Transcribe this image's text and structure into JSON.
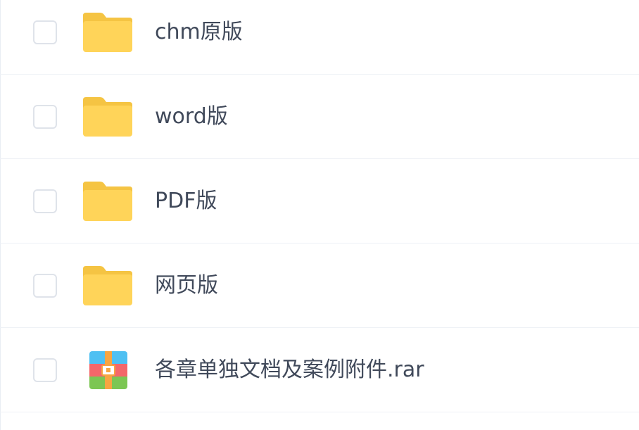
{
  "colors": {
    "folder": "#ffd459",
    "folder_tab": "#f5c443",
    "text": "#40495a",
    "row_border": "#eef1f6",
    "checkbox_border": "#dfe3ea"
  },
  "files": [
    {
      "name": "chm原版",
      "type": "folder",
      "icon": "folder-icon"
    },
    {
      "name": "word版",
      "type": "folder",
      "icon": "folder-icon"
    },
    {
      "name": "PDF版",
      "type": "folder",
      "icon": "folder-icon"
    },
    {
      "name": "网页版",
      "type": "folder",
      "icon": "folder-icon"
    },
    {
      "name": "各章单独文档及案例附件.rar",
      "type": "archive",
      "icon": "rar-archive-icon"
    }
  ]
}
